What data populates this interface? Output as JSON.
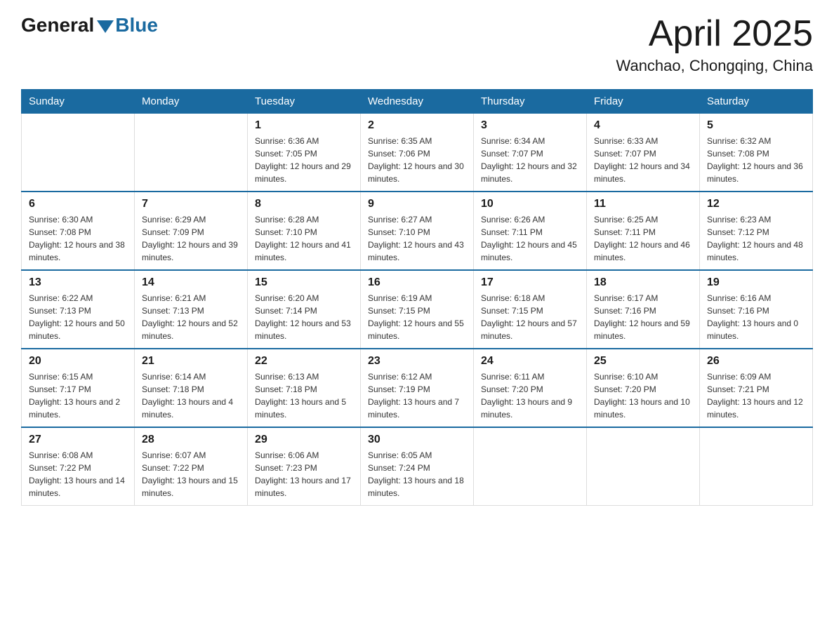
{
  "header": {
    "logo": {
      "general": "General",
      "blue": "Blue",
      "arrow_color": "#1a6aa0"
    },
    "title": "April 2025",
    "location": "Wanchao, Chongqing, China"
  },
  "calendar": {
    "days_of_week": [
      "Sunday",
      "Monday",
      "Tuesday",
      "Wednesday",
      "Thursday",
      "Friday",
      "Saturday"
    ],
    "weeks": [
      {
        "days": [
          {
            "number": "",
            "sunrise": "",
            "sunset": "",
            "daylight": ""
          },
          {
            "number": "",
            "sunrise": "",
            "sunset": "",
            "daylight": ""
          },
          {
            "number": "1",
            "sunrise": "Sunrise: 6:36 AM",
            "sunset": "Sunset: 7:05 PM",
            "daylight": "Daylight: 12 hours and 29 minutes."
          },
          {
            "number": "2",
            "sunrise": "Sunrise: 6:35 AM",
            "sunset": "Sunset: 7:06 PM",
            "daylight": "Daylight: 12 hours and 30 minutes."
          },
          {
            "number": "3",
            "sunrise": "Sunrise: 6:34 AM",
            "sunset": "Sunset: 7:07 PM",
            "daylight": "Daylight: 12 hours and 32 minutes."
          },
          {
            "number": "4",
            "sunrise": "Sunrise: 6:33 AM",
            "sunset": "Sunset: 7:07 PM",
            "daylight": "Daylight: 12 hours and 34 minutes."
          },
          {
            "number": "5",
            "sunrise": "Sunrise: 6:32 AM",
            "sunset": "Sunset: 7:08 PM",
            "daylight": "Daylight: 12 hours and 36 minutes."
          }
        ]
      },
      {
        "days": [
          {
            "number": "6",
            "sunrise": "Sunrise: 6:30 AM",
            "sunset": "Sunset: 7:08 PM",
            "daylight": "Daylight: 12 hours and 38 minutes."
          },
          {
            "number": "7",
            "sunrise": "Sunrise: 6:29 AM",
            "sunset": "Sunset: 7:09 PM",
            "daylight": "Daylight: 12 hours and 39 minutes."
          },
          {
            "number": "8",
            "sunrise": "Sunrise: 6:28 AM",
            "sunset": "Sunset: 7:10 PM",
            "daylight": "Daylight: 12 hours and 41 minutes."
          },
          {
            "number": "9",
            "sunrise": "Sunrise: 6:27 AM",
            "sunset": "Sunset: 7:10 PM",
            "daylight": "Daylight: 12 hours and 43 minutes."
          },
          {
            "number": "10",
            "sunrise": "Sunrise: 6:26 AM",
            "sunset": "Sunset: 7:11 PM",
            "daylight": "Daylight: 12 hours and 45 minutes."
          },
          {
            "number": "11",
            "sunrise": "Sunrise: 6:25 AM",
            "sunset": "Sunset: 7:11 PM",
            "daylight": "Daylight: 12 hours and 46 minutes."
          },
          {
            "number": "12",
            "sunrise": "Sunrise: 6:23 AM",
            "sunset": "Sunset: 7:12 PM",
            "daylight": "Daylight: 12 hours and 48 minutes."
          }
        ]
      },
      {
        "days": [
          {
            "number": "13",
            "sunrise": "Sunrise: 6:22 AM",
            "sunset": "Sunset: 7:13 PM",
            "daylight": "Daylight: 12 hours and 50 minutes."
          },
          {
            "number": "14",
            "sunrise": "Sunrise: 6:21 AM",
            "sunset": "Sunset: 7:13 PM",
            "daylight": "Daylight: 12 hours and 52 minutes."
          },
          {
            "number": "15",
            "sunrise": "Sunrise: 6:20 AM",
            "sunset": "Sunset: 7:14 PM",
            "daylight": "Daylight: 12 hours and 53 minutes."
          },
          {
            "number": "16",
            "sunrise": "Sunrise: 6:19 AM",
            "sunset": "Sunset: 7:15 PM",
            "daylight": "Daylight: 12 hours and 55 minutes."
          },
          {
            "number": "17",
            "sunrise": "Sunrise: 6:18 AM",
            "sunset": "Sunset: 7:15 PM",
            "daylight": "Daylight: 12 hours and 57 minutes."
          },
          {
            "number": "18",
            "sunrise": "Sunrise: 6:17 AM",
            "sunset": "Sunset: 7:16 PM",
            "daylight": "Daylight: 12 hours and 59 minutes."
          },
          {
            "number": "19",
            "sunrise": "Sunrise: 6:16 AM",
            "sunset": "Sunset: 7:16 PM",
            "daylight": "Daylight: 13 hours and 0 minutes."
          }
        ]
      },
      {
        "days": [
          {
            "number": "20",
            "sunrise": "Sunrise: 6:15 AM",
            "sunset": "Sunset: 7:17 PM",
            "daylight": "Daylight: 13 hours and 2 minutes."
          },
          {
            "number": "21",
            "sunrise": "Sunrise: 6:14 AM",
            "sunset": "Sunset: 7:18 PM",
            "daylight": "Daylight: 13 hours and 4 minutes."
          },
          {
            "number": "22",
            "sunrise": "Sunrise: 6:13 AM",
            "sunset": "Sunset: 7:18 PM",
            "daylight": "Daylight: 13 hours and 5 minutes."
          },
          {
            "number": "23",
            "sunrise": "Sunrise: 6:12 AM",
            "sunset": "Sunset: 7:19 PM",
            "daylight": "Daylight: 13 hours and 7 minutes."
          },
          {
            "number": "24",
            "sunrise": "Sunrise: 6:11 AM",
            "sunset": "Sunset: 7:20 PM",
            "daylight": "Daylight: 13 hours and 9 minutes."
          },
          {
            "number": "25",
            "sunrise": "Sunrise: 6:10 AM",
            "sunset": "Sunset: 7:20 PM",
            "daylight": "Daylight: 13 hours and 10 minutes."
          },
          {
            "number": "26",
            "sunrise": "Sunrise: 6:09 AM",
            "sunset": "Sunset: 7:21 PM",
            "daylight": "Daylight: 13 hours and 12 minutes."
          }
        ]
      },
      {
        "days": [
          {
            "number": "27",
            "sunrise": "Sunrise: 6:08 AM",
            "sunset": "Sunset: 7:22 PM",
            "daylight": "Daylight: 13 hours and 14 minutes."
          },
          {
            "number": "28",
            "sunrise": "Sunrise: 6:07 AM",
            "sunset": "Sunset: 7:22 PM",
            "daylight": "Daylight: 13 hours and 15 minutes."
          },
          {
            "number": "29",
            "sunrise": "Sunrise: 6:06 AM",
            "sunset": "Sunset: 7:23 PM",
            "daylight": "Daylight: 13 hours and 17 minutes."
          },
          {
            "number": "30",
            "sunrise": "Sunrise: 6:05 AM",
            "sunset": "Sunset: 7:24 PM",
            "daylight": "Daylight: 13 hours and 18 minutes."
          },
          {
            "number": "",
            "sunrise": "",
            "sunset": "",
            "daylight": ""
          },
          {
            "number": "",
            "sunrise": "",
            "sunset": "",
            "daylight": ""
          },
          {
            "number": "",
            "sunrise": "",
            "sunset": "",
            "daylight": ""
          }
        ]
      }
    ]
  }
}
